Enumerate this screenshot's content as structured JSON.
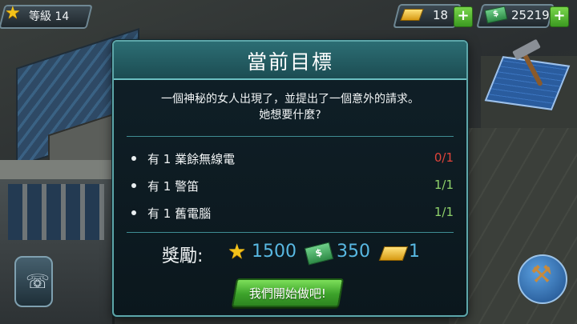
{
  "hud": {
    "level_label": "等級 14",
    "gold": "18",
    "cash": "25219",
    "plus": "+"
  },
  "dialog": {
    "title": "當前目標",
    "story_line1": "一個神秘的女人出現了，並提出了一個意外的請求。",
    "story_line2": "她想要什麼?",
    "objectives": [
      {
        "label": "有 1  業餘無線電",
        "progress": "0/1",
        "color": "#e0433a"
      },
      {
        "label": "有 1  警笛",
        "progress": "1/1",
        "color": "#8fd16a"
      },
      {
        "label": "有 1  舊電腦",
        "progress": "1/1",
        "color": "#8fd16a"
      }
    ],
    "rewards": {
      "label": "獎勵:",
      "xp": "1500",
      "cash": "350",
      "gold": "1"
    },
    "start_button": "我們開始做吧!"
  },
  "icons": {
    "level": "star-icon",
    "gold": "gold-bar-icon",
    "cash": "cash-icon",
    "phone": "phone-icon",
    "build": "hammer-icon",
    "auction": "gavel-icon"
  },
  "colors": {
    "accent_teal": "#5da6a9",
    "reward_blue": "#58b8e2",
    "incomplete_red": "#e0433a",
    "complete_green": "#8fd16a",
    "button_green": "#3ca22a"
  }
}
